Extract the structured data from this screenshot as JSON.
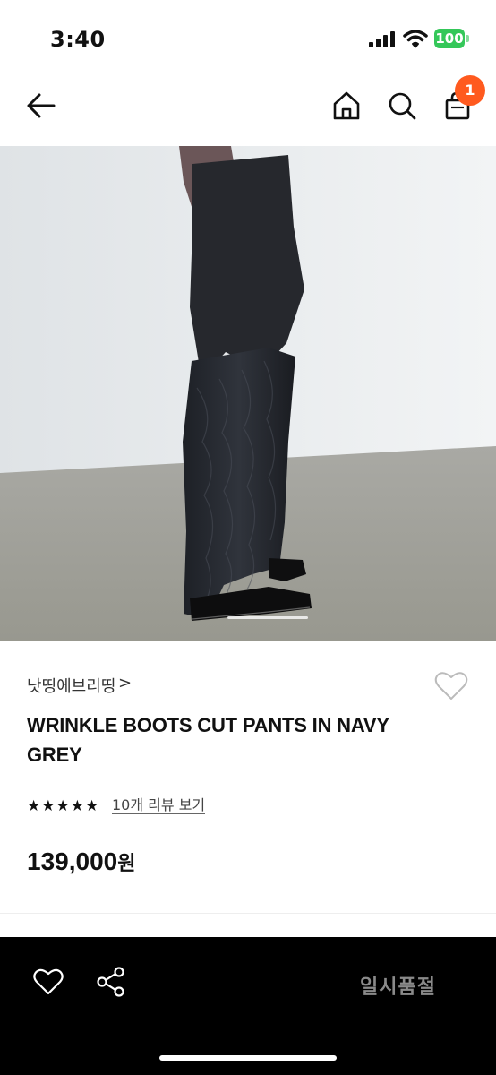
{
  "status_bar": {
    "time": "3:40",
    "battery": "100"
  },
  "nav": {
    "cart_count": "1"
  },
  "product": {
    "brand": "낫띵에브리띵",
    "brand_chevron": ">",
    "title": "WRINKLE BOOTS CUT PANTS IN NAVY GREY",
    "rating_stars": 5,
    "review_link": "10개 리뷰 보기",
    "price": "139,000",
    "price_unit": "원"
  },
  "bottom_bar": {
    "soldout_label": "일시품절"
  },
  "icons": {
    "back": "arrow-left-icon",
    "home": "home-icon",
    "search": "search-icon",
    "cart": "shopping-bag-icon",
    "wishlist": "heart-icon",
    "share": "share-icon"
  },
  "colors": {
    "badge": "#ff5a1f",
    "battery": "#34c759",
    "bottom_bar": "#000000",
    "soldout_text": "#8a8a8a"
  }
}
